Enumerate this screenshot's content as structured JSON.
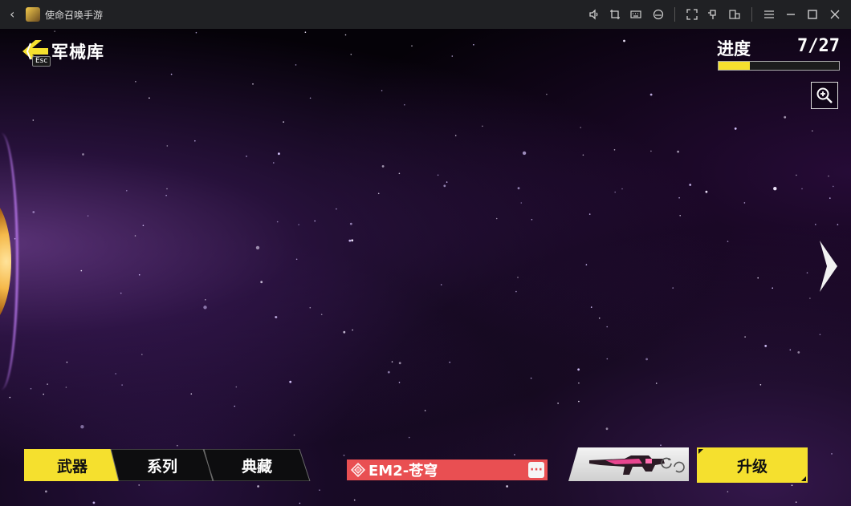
{
  "window": {
    "title": "使命召唤手游",
    "back_icon": "chevron-left-icon",
    "toolbar_icons": [
      "volume-icon",
      "crop-icon",
      "keyboard-icon",
      "gamepad-icon",
      "fullscreen-icon",
      "pin-icon",
      "multi-window-icon",
      "menu-icon",
      "minimize-icon",
      "maximize-icon",
      "close-icon"
    ]
  },
  "header": {
    "esc_label": "Esc",
    "title": "军械库",
    "progress_label": "进度",
    "progress_value": "7/27",
    "progress_fraction": 0.259
  },
  "controls": {
    "zoom_icon": "zoom-in-icon",
    "next_icon": "chevron-right-icon"
  },
  "tabs": [
    {
      "label": "武器",
      "active": true
    },
    {
      "label": "系列",
      "active": false
    },
    {
      "label": "典藏",
      "active": false
    }
  ],
  "weapon": {
    "name": "EM2-苍穹",
    "rarity_icon": "rarity-emblem-icon",
    "more_label": "···",
    "colors": {
      "name_bar": "#e94f52",
      "accent": "#f5e02e"
    }
  },
  "actions": {
    "upgrade_label": "升级"
  }
}
